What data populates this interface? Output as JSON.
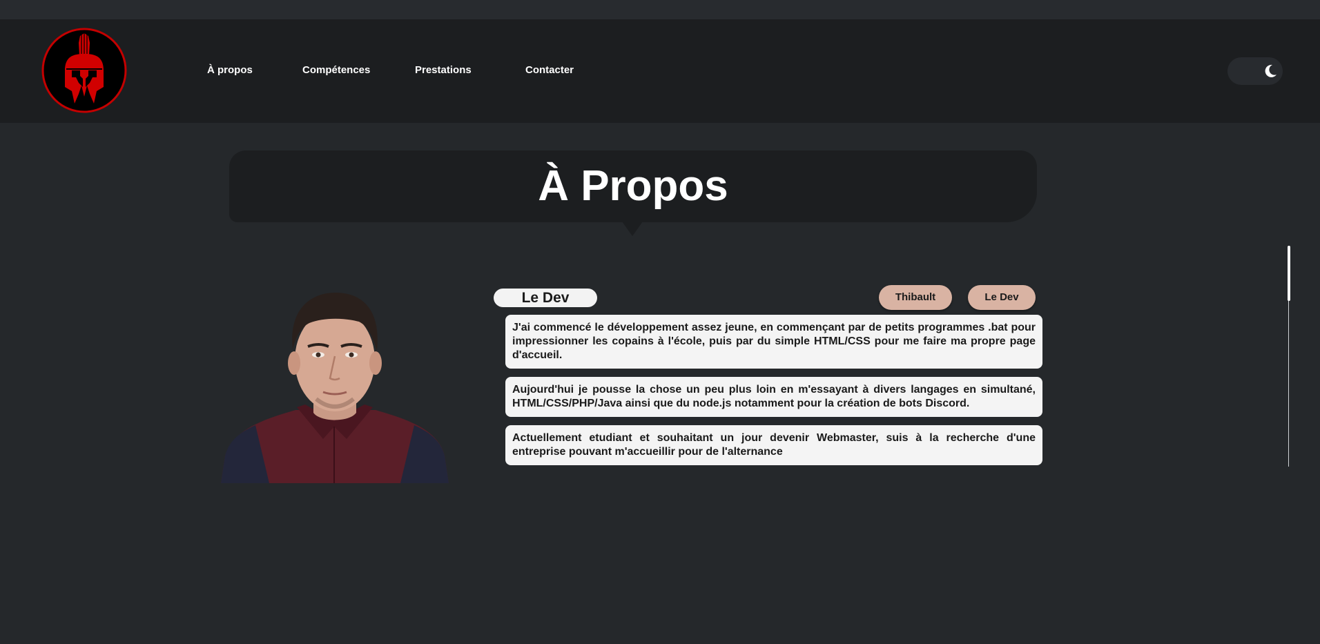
{
  "nav": {
    "logo_icon": "spartan-helmet-icon",
    "links": [
      "À propos",
      "Compétences",
      "Prestations",
      "Contacter"
    ],
    "theme_toggle_icon": "moon-icon"
  },
  "section": {
    "title": "À Propos"
  },
  "profile": {
    "portrait": "portrait-photo",
    "name_badge": "Le Dev",
    "tags": [
      "Thibault",
      "Le Dev"
    ],
    "paragraphs": [
      "J'ai commencé le développement assez jeune, en commençant par de petits programmes .bat pour impressionner les copains à l'école, puis par du simple HTML/CSS pour me faire ma propre page d'accueil.",
      "Aujourd'hui je pousse la chose un peu plus loin en m'essayant à divers langages en simultané, HTML/CSS/PHP/Java ainsi que du node.js notamment pour la création de bots Discord.",
      "Actuellement etudiant et souhaitant un jour devenir Webmaster, suis à la recherche d'une entreprise pouvant m'accueillir pour de l'alternance"
    ]
  },
  "colors": {
    "background": "#25282b",
    "navbar": "#1c1e20",
    "accent": "#d10000",
    "tag": "#d9b3a3",
    "card": "#f4f4f4"
  }
}
